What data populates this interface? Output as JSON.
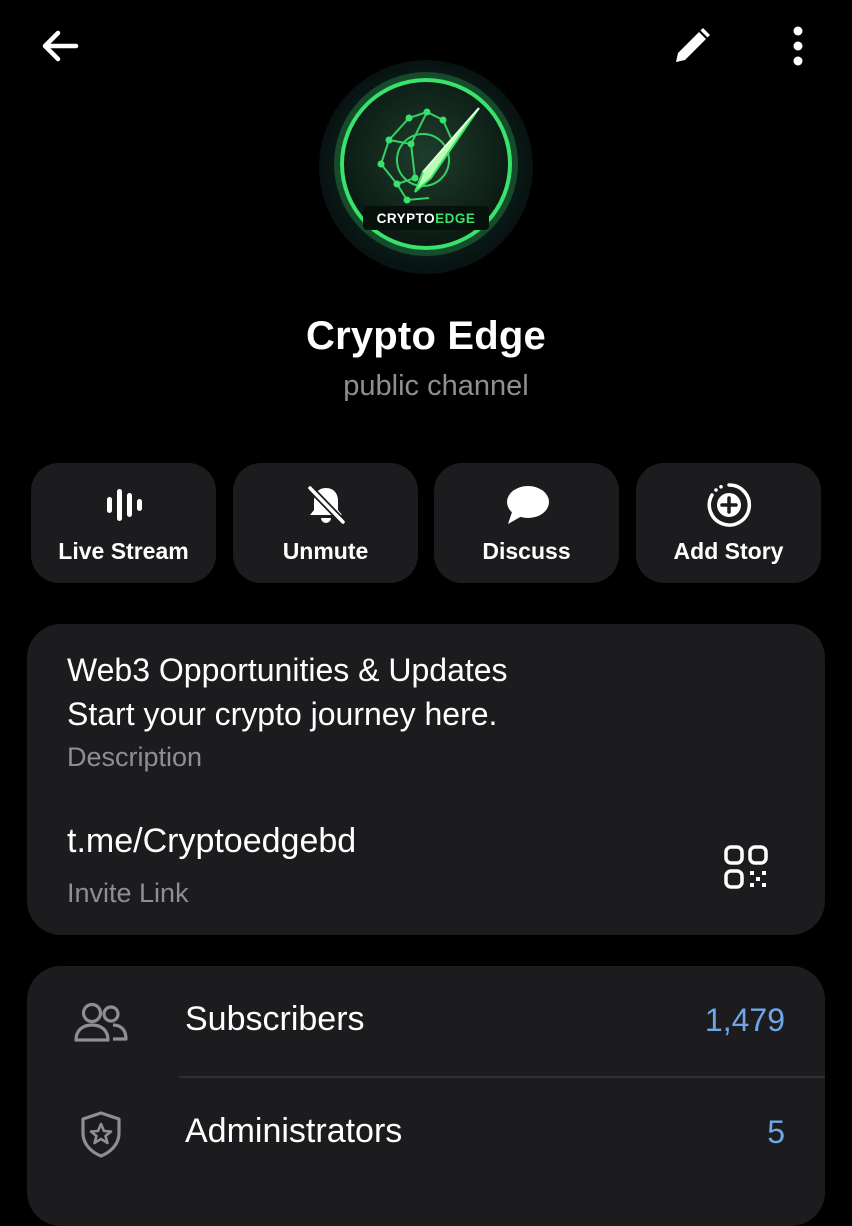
{
  "header": {
    "back_icon": "arrow-left-icon",
    "edit_icon": "pencil-icon",
    "more_icon": "more-vertical-icon"
  },
  "channel": {
    "avatar_text": "CRYPTOEDGE",
    "name": "Crypto Edge",
    "type": "public channel"
  },
  "actions": [
    {
      "label": "Live Stream",
      "icon": "live-stream-icon"
    },
    {
      "label": "Unmute",
      "icon": "bell-off-icon"
    },
    {
      "label": "Discuss",
      "icon": "chat-bubble-icon"
    },
    {
      "label": "Add Story",
      "icon": "add-story-icon"
    }
  ],
  "info": {
    "description_lines": [
      "Web3 Opportunities & Updates",
      "Start your crypto journey here."
    ],
    "description_label": "Description",
    "invite_link": "t.me/Cryptoedgebd",
    "invite_label": "Invite Link",
    "qr_icon": "qr-code-icon"
  },
  "members": [
    {
      "label": "Subscribers",
      "count": "1,479",
      "icon": "people-icon"
    },
    {
      "label": "Administrators",
      "count": "5",
      "icon": "shield-star-icon"
    }
  ],
  "colors": {
    "background": "#000000",
    "card": "#1c1c1e",
    "secondary_text": "#8e8e93",
    "accent": "#6ea6e8",
    "avatar_glow": "#39e26b"
  }
}
